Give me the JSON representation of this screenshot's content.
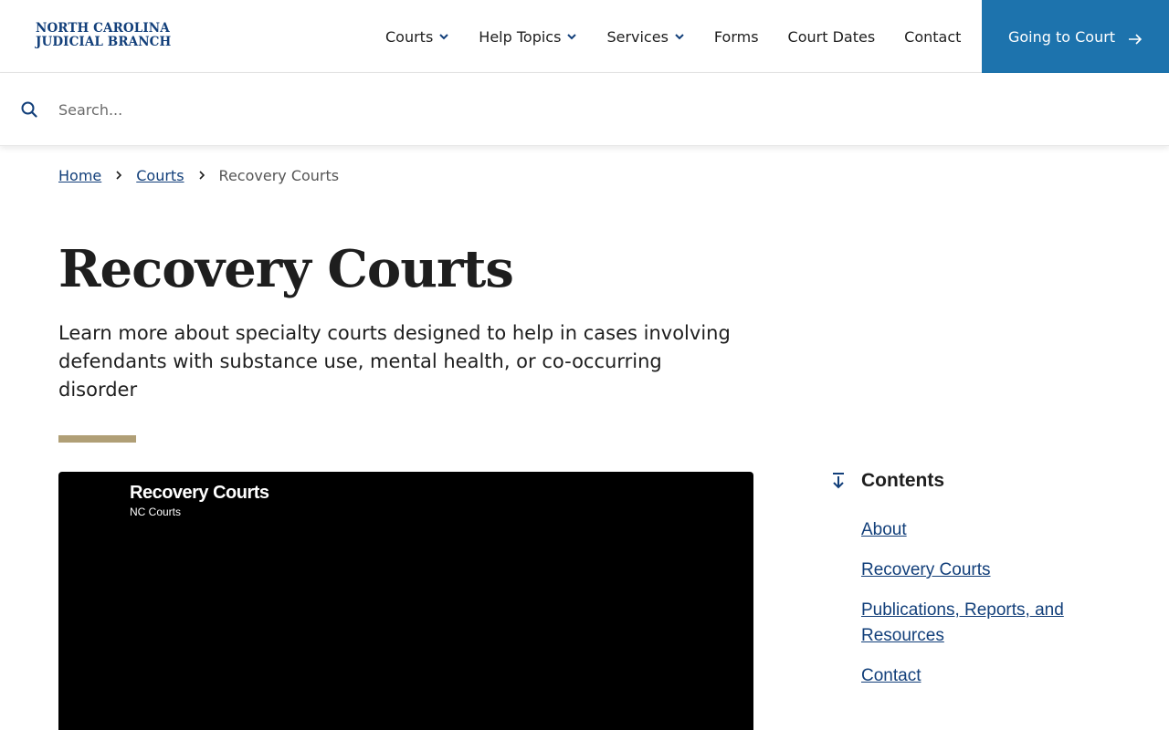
{
  "logo": {
    "line1": "NORTH CAROLINA",
    "line2": "JUDICIAL BRANCH"
  },
  "nav": {
    "items": [
      {
        "label": "Courts",
        "has_dropdown": true
      },
      {
        "label": "Help Topics",
        "has_dropdown": true
      },
      {
        "label": "Services",
        "has_dropdown": true
      },
      {
        "label": "Forms",
        "has_dropdown": false
      },
      {
        "label": "Court Dates",
        "has_dropdown": false
      },
      {
        "label": "Contact",
        "has_dropdown": false
      }
    ],
    "cta_label": "Going to Court"
  },
  "search": {
    "placeholder": "Search..."
  },
  "breadcrumb": {
    "home": "Home",
    "courts": "Courts",
    "current": "Recovery Courts"
  },
  "page": {
    "title": "Recovery Courts",
    "lede": "Learn more about specialty courts designed to help in cases involving defendants with substance use, mental health, or co-occurring disorder"
  },
  "video": {
    "title": "Recovery Courts",
    "channel": "NC Courts"
  },
  "toc": {
    "title": "Contents",
    "items": [
      "About",
      "Recovery Courts",
      "Publications, Reports, and Resources",
      "Contact"
    ]
  },
  "colors": {
    "brand_navy": "#123f7a",
    "cta_blue": "#1d73ad",
    "accent_gold": "#b09f76"
  }
}
